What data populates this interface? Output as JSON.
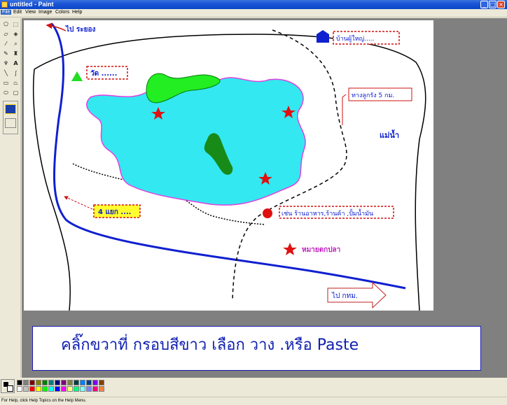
{
  "window": {
    "title": "untitled - Paint"
  },
  "title_buttons": {
    "minimize": "_",
    "maximize": "□",
    "close": "×"
  },
  "menu": [
    "File",
    "Edit",
    "View",
    "Image",
    "Colors",
    "Help"
  ],
  "map": {
    "to_rayong": "ไป ระยอง",
    "village_head": "บ้านผู้ใหญ่.....",
    "temple": "วัด ......",
    "laterite_road": "ทางลูกรัง 5 กม.",
    "river": "แม่น้ำ",
    "intersection": "4 แยก ....",
    "shops": "เช่น ร้านอาหาร,ร้านค้า ,ปั้มน้ำมัน",
    "fishing_spot": "หมายตกปลา",
    "to_bangkok": "ไป กทม."
  },
  "caption": "คลิ๊กขวาที่ กรอบสีขาว เลือก วาง .หรือ Paste",
  "status": "For Help, click Help Topics on the Help Menu.",
  "palette_colors": [
    "#000000",
    "#808080",
    "#800000",
    "#808000",
    "#008000",
    "#008080",
    "#000080",
    "#800080",
    "#808040",
    "#004040",
    "#0080ff",
    "#004080",
    "#8000ff",
    "#804000",
    "#ffffff",
    "#c0c0c0",
    "#ff0000",
    "#ffff00",
    "#00ff00",
    "#00ffff",
    "#0000ff",
    "#ff00ff",
    "#ffff80",
    "#00ff80",
    "#80ffff",
    "#8080ff",
    "#ff0080",
    "#ff8040"
  ]
}
